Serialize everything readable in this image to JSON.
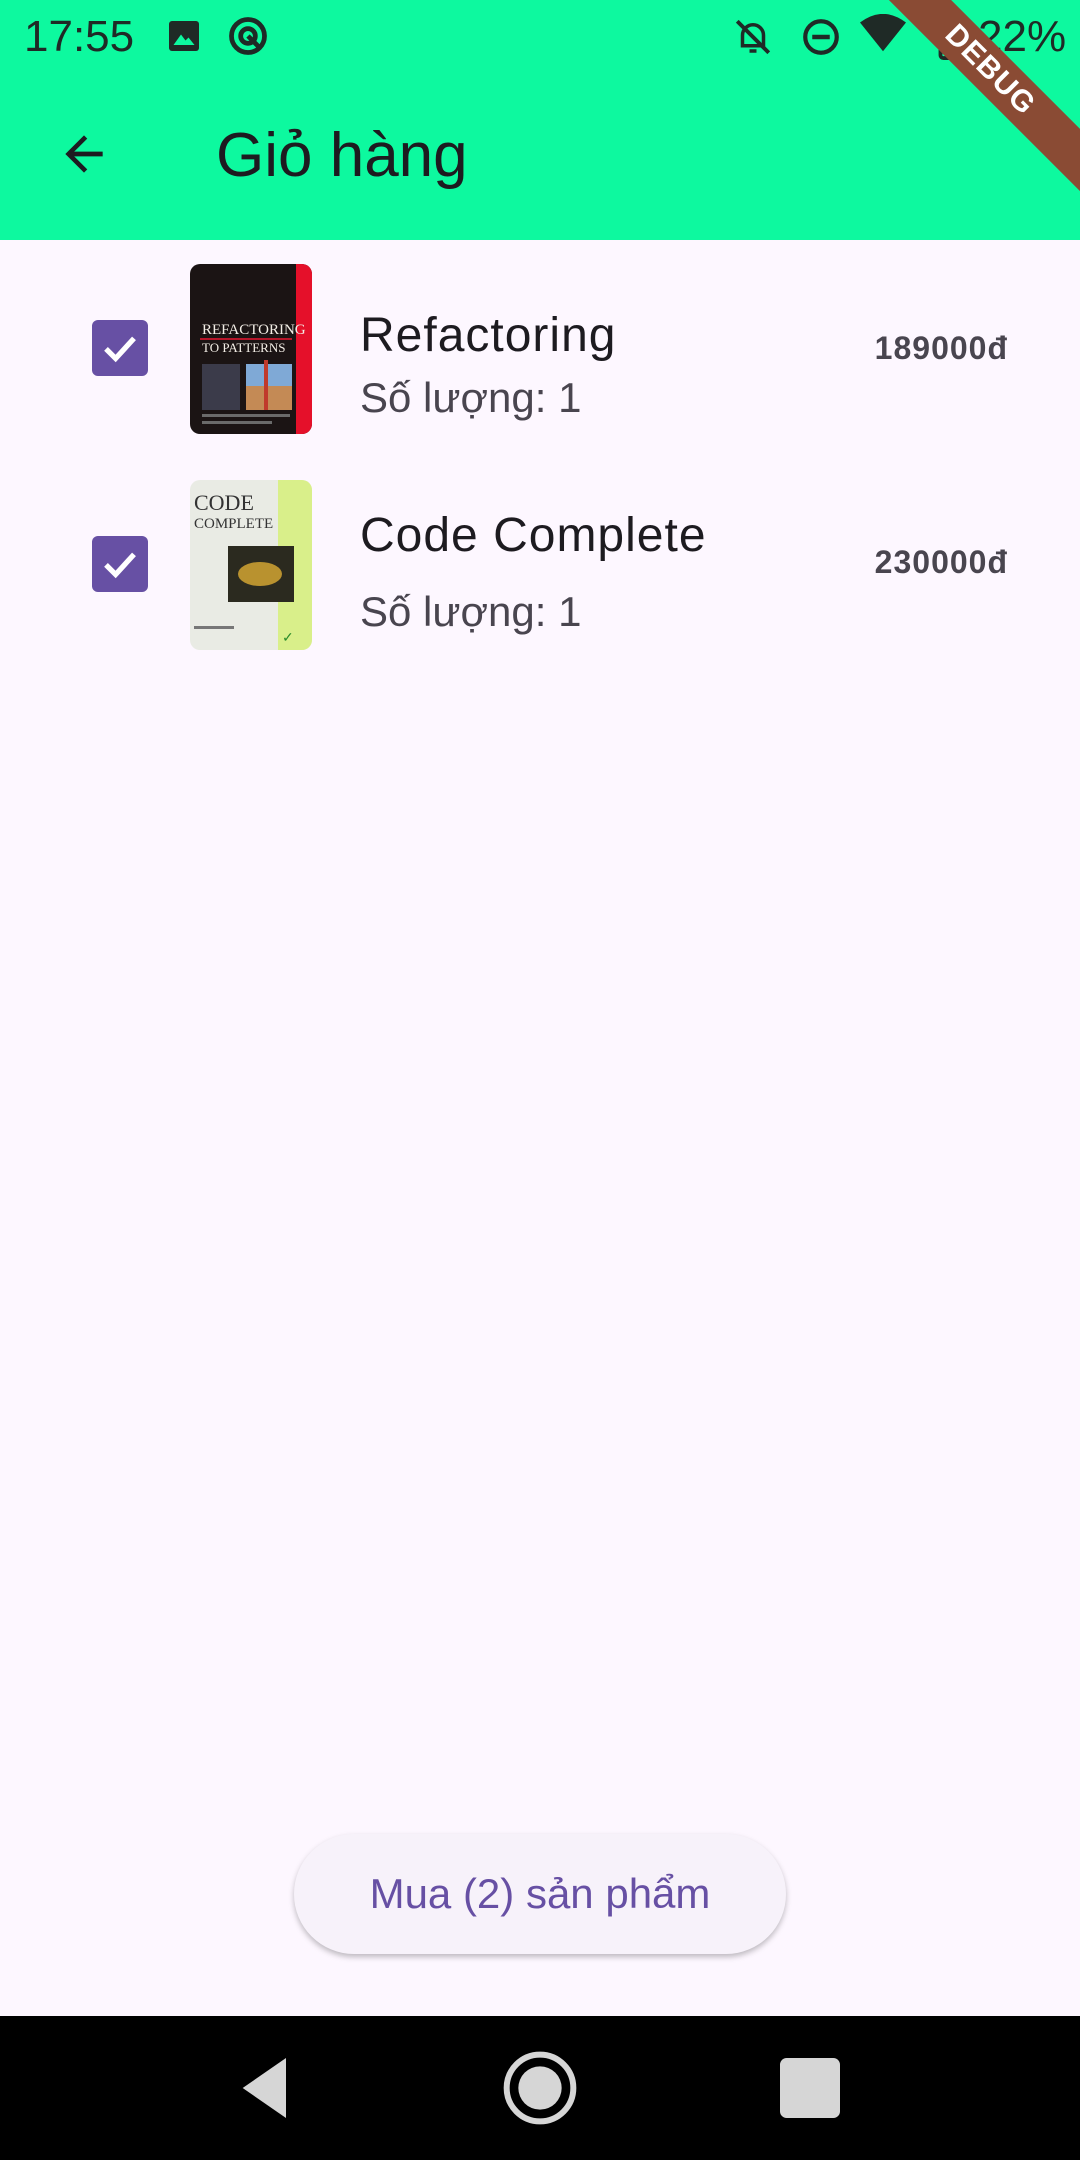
{
  "status_bar": {
    "time": "17:55",
    "battery": "22%",
    "debug_label": "DEBUG",
    "icons": [
      "image-icon",
      "vpn-icon",
      "bell-off-icon",
      "do-not-disturb-icon",
      "wifi-icon",
      "battery-icon"
    ]
  },
  "app_bar": {
    "title": "Giỏ hàng",
    "back_icon": "arrow-back-icon",
    "background": "#0df99f"
  },
  "cart": {
    "items": [
      {
        "title": "Refactoring",
        "quantity": "Số lượng: 1",
        "price": "189000đ",
        "checked": true,
        "cover": "Refactoring to Patterns"
      },
      {
        "title": "Code Complete",
        "quantity": "Số lượng: 1",
        "price": "230000đ",
        "checked": true,
        "cover": "Code Complete"
      }
    ]
  },
  "buy_button": {
    "label": "Mua (2) sản phẩm"
  },
  "colors": {
    "accent": "#6750a4",
    "background": "#fdf7ff"
  }
}
